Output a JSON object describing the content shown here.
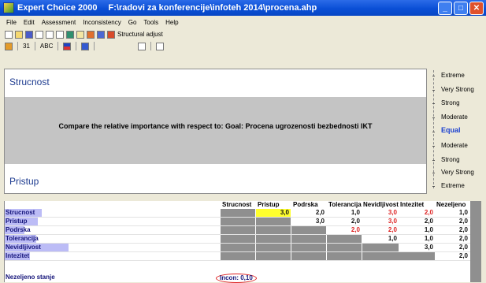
{
  "title": {
    "app": "Expert Choice 2000",
    "path": "F:\\radovi za konferencije\\infoteh 2014\\procena.ahp"
  },
  "menu": [
    "File",
    "Edit",
    "Assessment",
    "Inconsistency",
    "Go",
    "Tools",
    "Help"
  ],
  "toolbar": {
    "structural_adjust": "Structural adjust",
    "tb2_labels": [
      "31",
      "ABC"
    ]
  },
  "workarea": {
    "node_top": "Strucnost",
    "prompt": "Compare the relative importance  with respect to: Goal: Procena ugrozenosti bezbednosti IKT",
    "node_bottom": "Pristup"
  },
  "scale": [
    "Extreme",
    "Very Strong",
    "Strong",
    "Moderate",
    "Equal",
    "Moderate",
    "Strong",
    "Very Strong",
    "Extreme"
  ],
  "grid": {
    "columns": [
      "Strucnost",
      "Pristup",
      "Podrska",
      "Tolerancija",
      "Nevidljivost",
      "Intezitet",
      "Nezeljeno"
    ],
    "rows": [
      {
        "label": "Strucnost",
        "cells": [
          "",
          "3,0",
          "2,0",
          "1,0",
          "3,0",
          "2,0",
          "1,0"
        ]
      },
      {
        "label": "Pristup",
        "cells": [
          "",
          "",
          "3,0",
          "2,0",
          "3,0",
          "2,0",
          "2,0"
        ]
      },
      {
        "label": "Podrska",
        "cells": [
          "",
          "",
          "",
          "2,0",
          "2,0",
          "1,0",
          "2,0"
        ]
      },
      {
        "label": "Tolerancija",
        "cells": [
          "",
          "",
          "",
          "",
          "1,0",
          "1,0",
          "2,0"
        ]
      },
      {
        "label": "Nevidljivost",
        "cells": [
          "",
          "",
          "",
          "",
          "",
          "3,0",
          "2,0"
        ]
      },
      {
        "label": "Intezitet",
        "cells": [
          "",
          "",
          "",
          "",
          "",
          "",
          "2,0"
        ]
      },
      {
        "label": "Nezeljeno stanje",
        "cells": [
          "",
          "",
          "",
          "",
          "",
          "",
          ""
        ]
      }
    ],
    "inconsistency": "Incon: 0,10"
  },
  "colors": {
    "title_bar": "#0a4fd6",
    "selected_cell": "#ffff2c",
    "inverse_value": "#dd2222",
    "label_bar": "#bcbcf6"
  }
}
